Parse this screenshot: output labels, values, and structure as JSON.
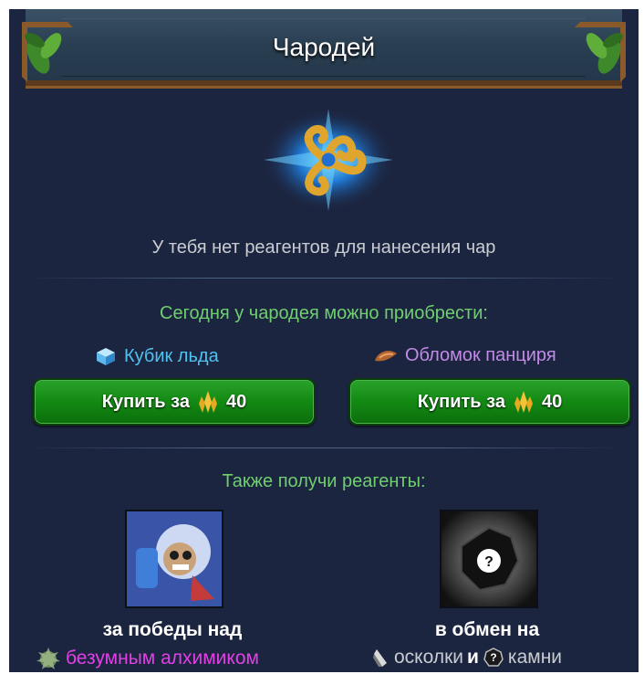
{
  "header": {
    "title": "Чародей"
  },
  "status": {
    "message": "У тебя нет реагентов для нанесения чар"
  },
  "shop": {
    "heading": "Сегодня у чародея можно приобрести:",
    "offers": [
      {
        "item": "Кубик льда",
        "icon": "ice-cube-icon",
        "color": "#4ec3f2",
        "button": "Купить за",
        "price": "40",
        "currency_icon": "gold-crystal-icon"
      },
      {
        "item": "Обломок панциря",
        "icon": "shell-fragment-icon",
        "color": "#c38be8",
        "button": "Купить за",
        "price": "40",
        "currency_icon": "gold-crystal-icon"
      }
    ]
  },
  "sources": {
    "heading": "Также получи реагенты:",
    "items": [
      {
        "caption": "за победы над",
        "link": "безумным алхимиком",
        "link_color": "#e23fe6",
        "icon": "alchemist-boss-icon"
      },
      {
        "caption": "в обмен на",
        "part1": "осколки",
        "joiner": "и",
        "part2": "камни",
        "icon": "mystery-stone-icon"
      }
    ]
  },
  "colors": {
    "panel": "#1c2540",
    "accent_green": "#6fcf6f",
    "button_green": "#138a13"
  }
}
